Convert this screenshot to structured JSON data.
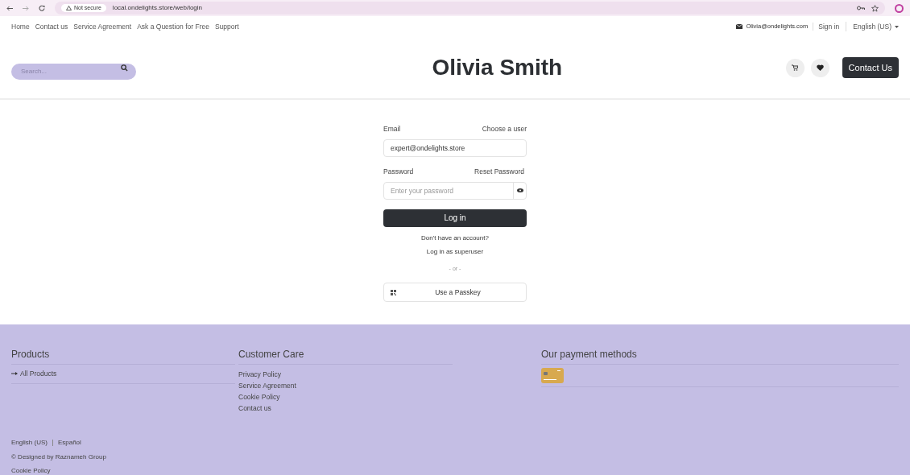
{
  "browser": {
    "security": "Not secure",
    "url": "local.ondelights.store/web/login"
  },
  "top_nav": {
    "links": [
      "Home",
      "Contact us",
      "Service Agreement",
      "Ask a Question for Free",
      "Support"
    ],
    "email": "Olivia@ondelights.com",
    "sign_in": "Sign in",
    "language": "English (US)"
  },
  "header": {
    "search": {
      "placeholder": "Search..."
    },
    "title": "Olivia Smith",
    "contact_button": "Contact Us"
  },
  "login": {
    "email_label": "Email",
    "choose_user": "Choose a user",
    "email_value": "expert@ondelights.store",
    "password_label": "Password",
    "reset_password": "Reset Password",
    "password_placeholder": "Enter your password",
    "login_button": "Log in",
    "no_account": "Don't have an account?",
    "superuser": "Log in as superuser",
    "or": "- or -",
    "passkey_button": "Use a Passkey"
  },
  "footer": {
    "products": {
      "title": "Products",
      "links": [
        "All Products"
      ]
    },
    "customer_care": {
      "title": "Customer Care",
      "links": [
        "Privacy Policy",
        "Service Agreement",
        "Cookie Policy",
        "Contact us"
      ]
    },
    "payment": {
      "title": "Our payment methods"
    },
    "languages": [
      "English (US)",
      "Español"
    ],
    "copyright": "© Designed by Raznameh Group",
    "cookie_policy": "Cookie Policy"
  }
}
